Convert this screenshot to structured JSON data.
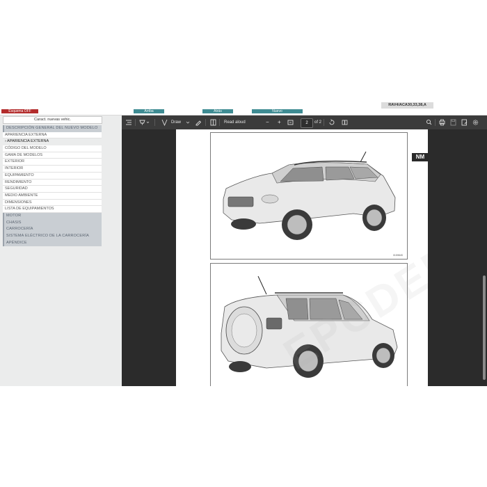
{
  "topbar": {
    "esquema_label": "Esquema OFF",
    "arriba_label": "Arriba",
    "atras_label": "Atrás",
    "nuevo_label": "Nuevo",
    "model_code": "RAV4/ACA30,33,38,A"
  },
  "sidebar": {
    "header": "Caract. nuevas vehic.",
    "items": [
      {
        "label": "DESCRIPCIÓN GENERAL DEL NUEVO MODELO",
        "kind": "sec"
      },
      {
        "label": "APARIENCIA EXTERNA",
        "kind": "sub"
      },
      {
        "label": "› APARIENCIA EXTERNA",
        "kind": "active"
      },
      {
        "label": "CÓDIGO DEL MODELO",
        "kind": "sub"
      },
      {
        "label": "GAMA DE MODELOS",
        "kind": "sub"
      },
      {
        "label": "EXTERIOR",
        "kind": "sub"
      },
      {
        "label": "INTERIOR",
        "kind": "sub"
      },
      {
        "label": "EQUIPAMIENTO",
        "kind": "sub"
      },
      {
        "label": "RENDIMIENTO",
        "kind": "sub"
      },
      {
        "label": "SEGURIDAD",
        "kind": "sub"
      },
      {
        "label": "MEDIO AMBIENTE",
        "kind": "sub"
      },
      {
        "label": "DIMENSIONES",
        "kind": "sub"
      },
      {
        "label": "LISTA DE EQUIPAMIENTOS",
        "kind": "sub"
      },
      {
        "label": "MOTOR",
        "kind": "sec"
      },
      {
        "label": "CHASIS",
        "kind": "sec"
      },
      {
        "label": "CARROCERÍA",
        "kind": "sec"
      },
      {
        "label": "SISTEMA ELÉCTRICO DE LA CARROCERÍA",
        "kind": "sec"
      },
      {
        "label": "APÉNDICE",
        "kind": "sec"
      }
    ]
  },
  "pdf_toolbar": {
    "draw_label": "Draw",
    "read_aloud_label": "Read aloud",
    "minus": "−",
    "plus": "+",
    "page_current": "2",
    "page_total": "of 2"
  },
  "document": {
    "badge": "NM",
    "figure_code": "015984S",
    "watermark": "EPCDEPOT.COM"
  },
  "colors": {
    "esquema": "#b32d2d",
    "nav_buttons": "#3f8c93",
    "viewer_bg": "#2b2b2b",
    "toolbar_bg": "#3b3b3b"
  }
}
